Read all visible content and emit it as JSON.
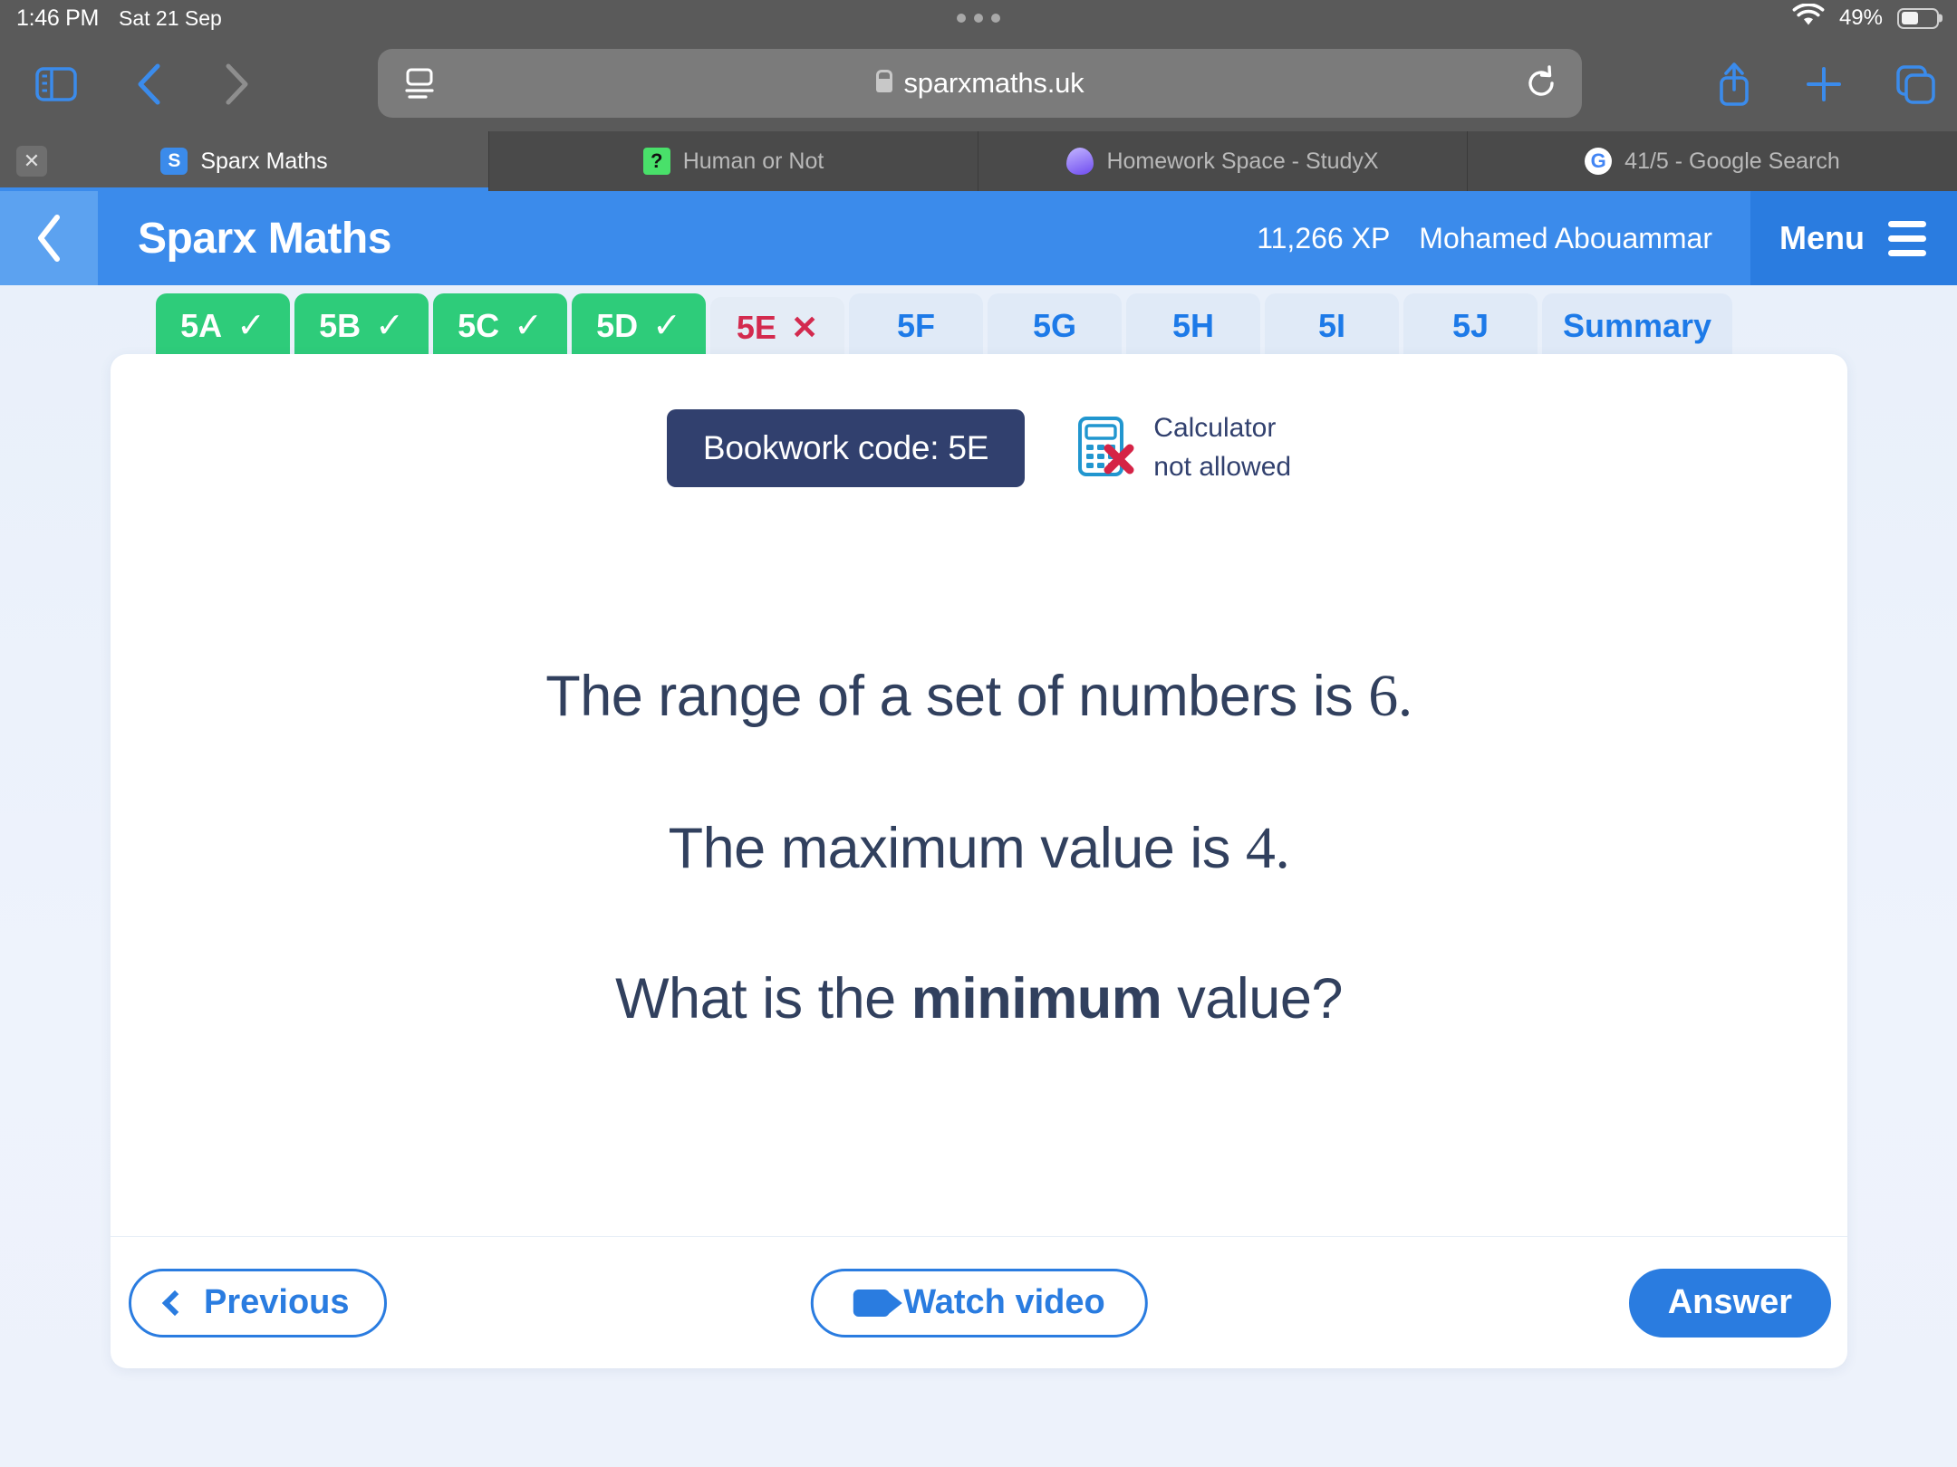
{
  "status_bar": {
    "time": "1:46 PM",
    "date": "Sat 21 Sep",
    "battery_percent": "49%",
    "wifi_icon": "wifi-icon",
    "battery_icon": "battery-icon"
  },
  "browser": {
    "sidebar_icon": "sidebar-icon",
    "back_icon": "chevron-left-icon",
    "forward_icon": "chevron-right-icon",
    "reader_icon": "reader-view-icon",
    "reload_icon": "reload-icon",
    "share_icon": "share-icon",
    "new_tab_icon": "plus-icon",
    "tabs_overview_icon": "tabs-icon",
    "url": "sparxmaths.uk",
    "lock_icon": "lock-icon",
    "tabs": [
      {
        "title": "Sparx Maths",
        "favicon": "sparx-favicon",
        "favicon_letter": "S",
        "active": true,
        "close_icon": "close-icon"
      },
      {
        "title": "Human or Not",
        "favicon": "human-or-not-favicon",
        "favicon_letter": "?",
        "active": false
      },
      {
        "title": "Homework Space - StudyX",
        "favicon": "studyx-favicon",
        "favicon_letter": "",
        "active": false
      },
      {
        "title": "41/5 - Google Search",
        "favicon": "google-favicon",
        "favicon_letter": "G",
        "active": false
      }
    ]
  },
  "app_header": {
    "back_icon": "chevron-left-icon",
    "title": "Sparx Maths",
    "xp": "11,266 XP",
    "user_name": "Mohamed Abouammar",
    "menu_label": "Menu",
    "menu_icon": "hamburger-icon",
    "accent_color": "#3b8beb",
    "menu_bg_color": "#2a7ce0"
  },
  "question_tabs": [
    {
      "label": "5A",
      "state": "done",
      "marker": "✓"
    },
    {
      "label": "5B",
      "state": "done",
      "marker": "✓"
    },
    {
      "label": "5C",
      "state": "done",
      "marker": "✓"
    },
    {
      "label": "5D",
      "state": "done",
      "marker": "✓"
    },
    {
      "label": "5E",
      "state": "wrong",
      "marker": "✕"
    },
    {
      "label": "5F",
      "state": "todo",
      "marker": ""
    },
    {
      "label": "5G",
      "state": "todo",
      "marker": ""
    },
    {
      "label": "5H",
      "state": "todo",
      "marker": ""
    },
    {
      "label": "5I",
      "state": "todo",
      "marker": ""
    },
    {
      "label": "5J",
      "state": "todo",
      "marker": ""
    },
    {
      "label": "Summary",
      "state": "summary",
      "marker": ""
    }
  ],
  "card": {
    "bookwork_code": "Bookwork code: 5E",
    "calculator_icon": "calculator-not-allowed-icon",
    "calculator_line1": "Calculator",
    "calculator_line2": "not allowed",
    "question": {
      "line1_pre": "The range of a set of numbers is ",
      "line1_num": "6.",
      "line2_pre": "The maximum value is ",
      "line2_num": "4.",
      "line3_pre": "What is the ",
      "line3_bold": "minimum",
      "line3_post": " value?"
    }
  },
  "footer": {
    "previous_label": "Previous",
    "previous_icon": "chevron-left-icon",
    "watch_video_label": "Watch video",
    "watch_video_icon": "video-camera-icon",
    "answer_label": "Answer"
  },
  "colors": {
    "sparx_blue": "#3b8beb",
    "button_blue": "#2a7ce0",
    "done_green": "#2ecc7a",
    "wrong_red": "#d32a4e",
    "bookwork_navy": "#31406e",
    "text_navy": "#31405e",
    "page_bg": "#eaf1fb"
  }
}
